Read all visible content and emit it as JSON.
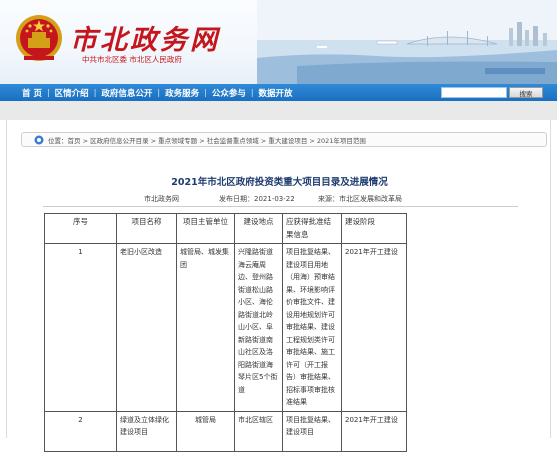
{
  "header": {
    "site_title": "市北政务网",
    "site_sub": "中共市北区委  市北区人民政府",
    "emblem_icon": "national-emblem-icon",
    "title_color": "#c4161c"
  },
  "nav": {
    "items": [
      "首 页",
      "区情介绍",
      "政府信息公开",
      "政务服务",
      "公众参与",
      "数据开放"
    ],
    "search_button": "搜索",
    "bg_color": "#1a6fc0"
  },
  "breadcrumb": {
    "icon": "location-icon",
    "text": "位置：首页 > 区政府信息公开目录 > 重点领域专题 > 社会监督重点领域 > 重大建设项目 > 2021年项目范围"
  },
  "article": {
    "title": "2021年市北区政府投资类重大项目目录及进展情况",
    "source": "市北政务网",
    "publish_date": "发布日期：2021-03-22",
    "origin": "来源：市北区发展和改革局"
  },
  "table": {
    "headers": [
      "序号",
      "项目名称",
      "项目主管单位",
      "建设地点",
      "应获得批准结果信息",
      "建设阶段"
    ],
    "rows": [
      [
        "1",
        "老旧小区改造",
        "城管局、城发集团",
        "兴隆路街道海云庵周边、登州路街道松山路小区、海伦路街道北岭山小区、阜新路街道南山社区及洛阳路街道海琴片区5个街道",
        "项目批复结果、建设项目用地（用海）预审结果、环境影响评价审批文件、建设用地规划许可审批结果、建设工程规划类许可审批结果、施工许可（开工报告）审批结果、招标事项审批核准结果",
        "2021年开工建设"
      ],
      [
        "2",
        "绿道及立体绿化建设项目",
        "城管局",
        "市北区辖区",
        "项目批复结果、建设项目",
        "2021年开工建设"
      ]
    ]
  }
}
